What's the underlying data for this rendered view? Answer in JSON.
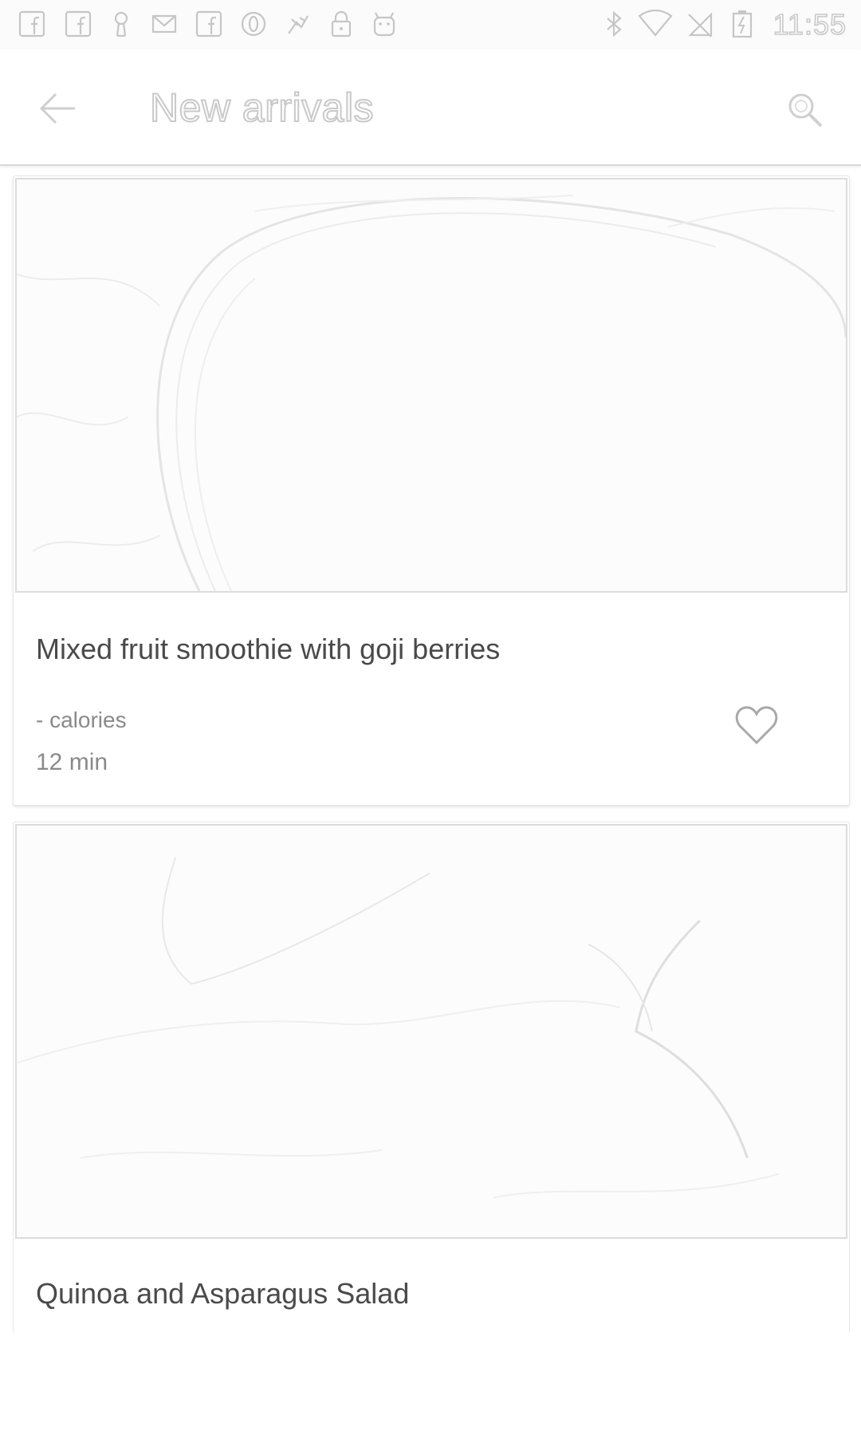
{
  "status_bar": {
    "time": "11:55",
    "left_icons": [
      "facebook-icon",
      "facebook-icon",
      "keyhole-icon",
      "mail-icon",
      "facebook-icon",
      "opera-icon",
      "fly-icon",
      "lock-icon",
      "android-icon"
    ],
    "right_icons": [
      "bluetooth-icon",
      "wifi-icon",
      "no-sim-icon",
      "battery-charging-icon"
    ]
  },
  "toolbar": {
    "back_icon": "arrow-back-icon",
    "title": "New arrivals",
    "search_icon": "search-icon"
  },
  "recipes": [
    {
      "title": "Mixed fruit smoothie with goji berries",
      "calories": "- calories",
      "time": "12 min",
      "favorite_icon": "heart-outline-icon"
    },
    {
      "title": "Quinoa and Asparagus Salad"
    }
  ]
}
